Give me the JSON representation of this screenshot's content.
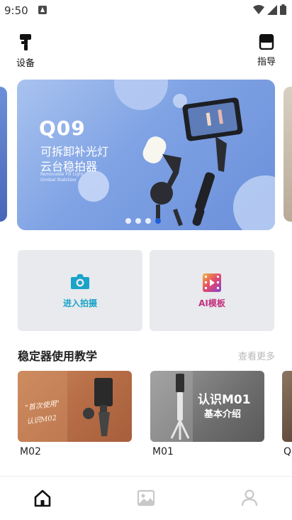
{
  "status_bar": {
    "time": "9:50"
  },
  "top_nav": {
    "device_label": "设备",
    "guide_label": "指导"
  },
  "banner": {
    "title": "Q09",
    "line1": "可拆卸补光灯",
    "line2": "云台稳拍器",
    "en_line1": "Removable Fill Light",
    "en_line2": "Gimbal Stabilizer",
    "page_count": 4,
    "active_page": 4
  },
  "actions": {
    "capture_label": "进入拍摄",
    "ai_template_label": "AI模板"
  },
  "tutorials": {
    "title": "稳定器使用教学",
    "more_label": "查看更多",
    "items": [
      {
        "caption": "M02",
        "overlay_line1": "\"首次使用\"",
        "overlay_line2": "认识M02"
      },
      {
        "caption": "M01",
        "overlay_line1": "认识M01",
        "overlay_line2": "基本介绍"
      },
      {
        "caption": "Q"
      }
    ]
  },
  "colors": {
    "accent_blue": "#1f5fd6",
    "capture_teal": "#1aa3c9",
    "ai_magenta": "#c3307e"
  },
  "bottom_nav": {
    "items": [
      {
        "icon": "home-icon",
        "selected": true
      },
      {
        "icon": "gallery-icon",
        "selected": false
      },
      {
        "icon": "profile-icon",
        "selected": false
      }
    ]
  }
}
